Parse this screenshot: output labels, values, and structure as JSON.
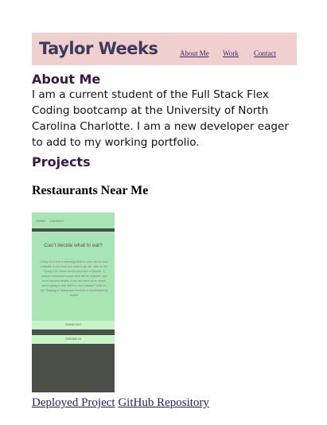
{
  "header": {
    "title": "Taylor Weeks",
    "nav": [
      "About Me",
      "Work",
      "Contact"
    ]
  },
  "about": {
    "heading": "About Me",
    "text": "I am a current student of the Full Stack Flex Coding bootcamp at the University of North Carolina Charlotte. I am a new developer eager to add to my working portfolio."
  },
  "projects": {
    "heading": "Projects",
    "items": [
      {
        "title": "Restaurants Near Me",
        "preview": {
          "nav": [
            "HOME",
            "CONTACT"
          ],
          "heading": "Can't decide what to eat?",
          "body": "Going out to eat or teaching what to cook can be such a hassle. If you know you want to go out, click on the \"Going Out\" button below and enter a Zipcode. A random restaurant in your area will be selected, and more big bold details. If you are there know where you're going to eat! Want to cook instead? Click on the \"Staying In\" button and discover a mouthwatering recipe!",
          "buttons": [
            "GOING OUT",
            "STAYING IN"
          ]
        },
        "links": [
          "Deployed Project",
          "GitHub Repository"
        ]
      }
    ]
  }
}
